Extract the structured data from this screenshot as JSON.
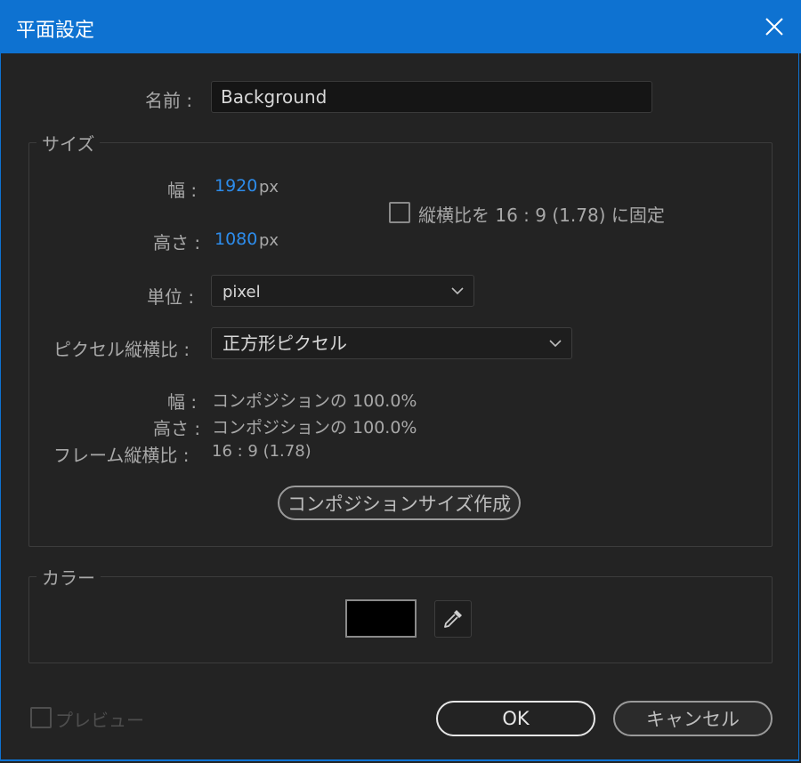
{
  "window": {
    "title": "平面設定"
  },
  "name_field": {
    "label": "名前 :",
    "value": "Background"
  },
  "size": {
    "legend": "サイズ",
    "width_label": "幅 :",
    "width_value": "1920",
    "width_unit": "px",
    "height_label": "高さ :",
    "height_value": "1080",
    "height_unit": "px",
    "lock_aspect_label": "縦横比を 16 : 9 (1.78) に固定",
    "lock_aspect_checked": false,
    "units_label": "単位 :",
    "units_value": "pixel",
    "pixel_aspect_label": "ピクセル縦横比 :",
    "pixel_aspect_value": "正方形ピクセル",
    "comp_width_label": "幅 :",
    "comp_width_value": "コンポジションの 100.0%",
    "comp_height_label": "高さ :",
    "comp_height_value": "コンポジションの 100.0%",
    "frame_aspect_label": "フレーム縦横比 :",
    "frame_aspect_value": "16 : 9 (1.78)",
    "make_comp_size_button": "コンポジションサイズ作成"
  },
  "color": {
    "legend": "カラー",
    "swatch_color": "#000000"
  },
  "footer": {
    "preview_label": "プレビュー",
    "preview_checked": false,
    "ok_label": "OK",
    "cancel_label": "キャンセル"
  },
  "colors": {
    "titlebar": "#0e72d1",
    "background": "#232323",
    "value_blue": "#2d8ceb"
  }
}
